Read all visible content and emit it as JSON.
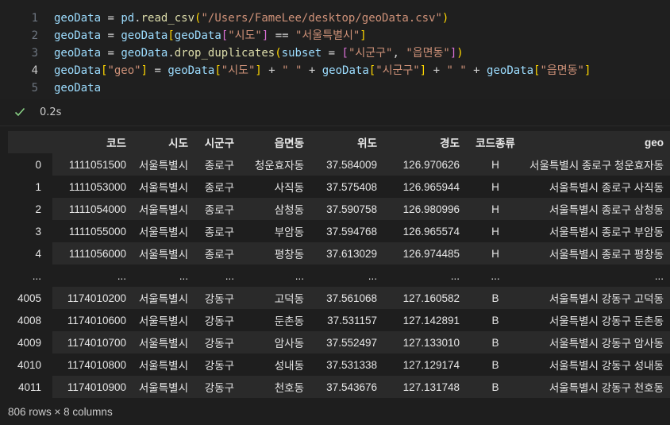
{
  "code": {
    "lines": [
      {
        "num": "1",
        "tokens": [
          {
            "t": "geoData",
            "c": "var"
          },
          {
            "t": " = ",
            "c": "op"
          },
          {
            "t": "pd",
            "c": "var"
          },
          {
            "t": ".",
            "c": "op"
          },
          {
            "t": "read_csv",
            "c": "fn"
          },
          {
            "t": "(",
            "c": "b1"
          },
          {
            "t": "\"/Users/FameLee/desktop/geoData.csv\"",
            "c": "str"
          },
          {
            "t": ")",
            "c": "b1"
          }
        ]
      },
      {
        "num": "2",
        "tokens": [
          {
            "t": "geoData",
            "c": "var"
          },
          {
            "t": " = ",
            "c": "op"
          },
          {
            "t": "geoData",
            "c": "var"
          },
          {
            "t": "[",
            "c": "b1"
          },
          {
            "t": "geoData",
            "c": "var"
          },
          {
            "t": "[",
            "c": "b2"
          },
          {
            "t": "\"시도\"",
            "c": "str"
          },
          {
            "t": "]",
            "c": "b2"
          },
          {
            "t": " == ",
            "c": "op"
          },
          {
            "t": "\"서울특별시\"",
            "c": "str"
          },
          {
            "t": "]",
            "c": "b1"
          }
        ]
      },
      {
        "num": "3",
        "tokens": [
          {
            "t": "geoData",
            "c": "var"
          },
          {
            "t": " = ",
            "c": "op"
          },
          {
            "t": "geoData",
            "c": "var"
          },
          {
            "t": ".",
            "c": "op"
          },
          {
            "t": "drop_duplicates",
            "c": "fn"
          },
          {
            "t": "(",
            "c": "b1"
          },
          {
            "t": "subset",
            "c": "var"
          },
          {
            "t": " = ",
            "c": "op"
          },
          {
            "t": "[",
            "c": "b2"
          },
          {
            "t": "\"시군구\"",
            "c": "str"
          },
          {
            "t": ", ",
            "c": "op"
          },
          {
            "t": "\"읍면동\"",
            "c": "str"
          },
          {
            "t": "]",
            "c": "b2"
          },
          {
            "t": ")",
            "c": "b1"
          }
        ]
      },
      {
        "num": "4",
        "tokens": [
          {
            "t": "geoData",
            "c": "var"
          },
          {
            "t": "[",
            "c": "b1"
          },
          {
            "t": "\"geo\"",
            "c": "str"
          },
          {
            "t": "]",
            "c": "b1"
          },
          {
            "t": " = ",
            "c": "op"
          },
          {
            "t": "geoData",
            "c": "var"
          },
          {
            "t": "[",
            "c": "b1"
          },
          {
            "t": "\"시도\"",
            "c": "str"
          },
          {
            "t": "]",
            "c": "b1"
          },
          {
            "t": " + ",
            "c": "op"
          },
          {
            "t": "\" \"",
            "c": "str"
          },
          {
            "t": " + ",
            "c": "op"
          },
          {
            "t": "geoData",
            "c": "var"
          },
          {
            "t": "[",
            "c": "b1"
          },
          {
            "t": "\"시군구\"",
            "c": "str"
          },
          {
            "t": "]",
            "c": "b1"
          },
          {
            "t": " + ",
            "c": "op"
          },
          {
            "t": "\" \"",
            "c": "str"
          },
          {
            "t": " + ",
            "c": "op"
          },
          {
            "t": "geoData",
            "c": "var"
          },
          {
            "t": "[",
            "c": "b1"
          },
          {
            "t": "\"읍면동\"",
            "c": "str"
          },
          {
            "t": "]",
            "c": "b1"
          }
        ]
      },
      {
        "num": "5",
        "tokens": [
          {
            "t": "geoData",
            "c": "var"
          }
        ]
      }
    ]
  },
  "status": {
    "icon": "check-icon",
    "time": "0.2s",
    "color": "#89d185"
  },
  "table": {
    "columns": [
      "",
      "코드",
      "시도",
      "시군구",
      "읍면동",
      "위도",
      "경도",
      "코드종류",
      "geo"
    ],
    "rows": [
      [
        "0",
        "1111051500",
        "서울특별시",
        "종로구",
        "청운효자동",
        "37.584009",
        "126.970626",
        "H",
        "서울특별시 종로구 청운효자동"
      ],
      [
        "1",
        "1111053000",
        "서울특별시",
        "종로구",
        "사직동",
        "37.575408",
        "126.965944",
        "H",
        "서울특별시 종로구 사직동"
      ],
      [
        "2",
        "1111054000",
        "서울특별시",
        "종로구",
        "삼청동",
        "37.590758",
        "126.980996",
        "H",
        "서울특별시 종로구 삼청동"
      ],
      [
        "3",
        "1111055000",
        "서울특별시",
        "종로구",
        "부암동",
        "37.594768",
        "126.965574",
        "H",
        "서울특별시 종로구 부암동"
      ],
      [
        "4",
        "1111056000",
        "서울특별시",
        "종로구",
        "평창동",
        "37.613029",
        "126.974485",
        "H",
        "서울특별시 종로구 평창동"
      ],
      [
        "...",
        "...",
        "...",
        "...",
        "...",
        "...",
        "...",
        "...",
        "..."
      ],
      [
        "4005",
        "1174010200",
        "서울특별시",
        "강동구",
        "고덕동",
        "37.561068",
        "127.160582",
        "B",
        "서울특별시 강동구 고덕동"
      ],
      [
        "4008",
        "1174010600",
        "서울특별시",
        "강동구",
        "둔촌동",
        "37.531157",
        "127.142891",
        "B",
        "서울특별시 강동구 둔촌동"
      ],
      [
        "4009",
        "1174010700",
        "서울특별시",
        "강동구",
        "암사동",
        "37.552497",
        "127.133010",
        "B",
        "서울특별시 강동구 암사동"
      ],
      [
        "4010",
        "1174010800",
        "서울특별시",
        "강동구",
        "성내동",
        "37.531338",
        "127.129174",
        "B",
        "서울특별시 강동구 성내동"
      ],
      [
        "4011",
        "1174010900",
        "서울특별시",
        "강동구",
        "천호동",
        "37.543676",
        "127.131748",
        "B",
        "서울특별시 강동구 천호동"
      ]
    ]
  },
  "shape": "806 rows × 8 columns"
}
